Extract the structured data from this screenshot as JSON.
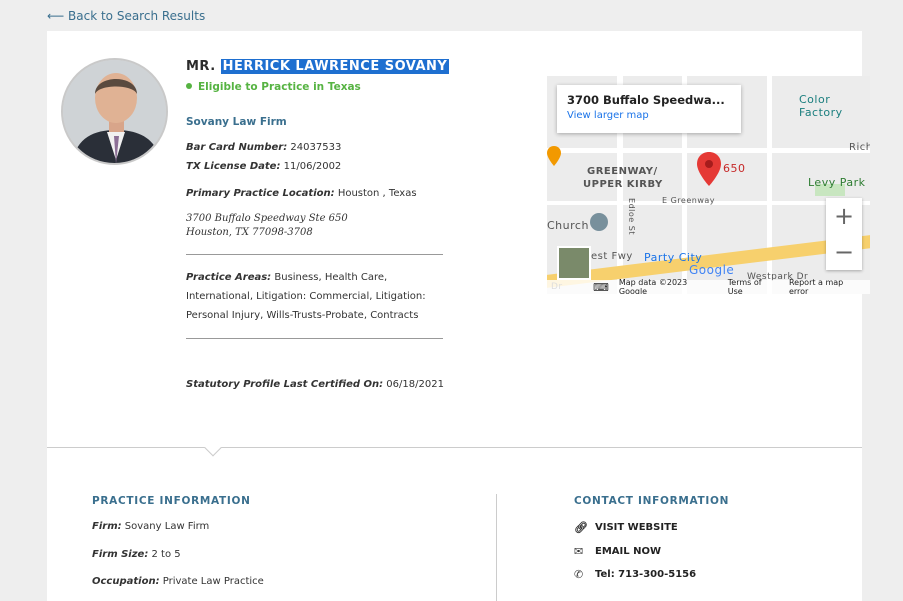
{
  "nav": {
    "back_label": "⟵ Back to Search Results"
  },
  "profile": {
    "prefix": "MR.",
    "name": "HERRICK LAWRENCE SOVANY",
    "eligibility": "Eligible to Practice in Texas",
    "firm": "Sovany Law Firm",
    "bar_card_label": "Bar Card Number:",
    "bar_card_value": "24037533",
    "license_label": "TX License Date:",
    "license_value": "11/06/2002",
    "location_label": "Primary Practice Location:",
    "location_value": "Houston , Texas",
    "address_line1": "3700 Buffalo Speedway Ste 650",
    "address_line2": "Houston, TX 77098-3708",
    "practice_areas_label": "Practice Areas:",
    "practice_areas_value": "Business, Health Care, International, Litigation: Commercial, Litigation: Personal Injury, Wills-Trusts-Probate, Contracts",
    "certified_label": "Statutory Profile Last Certified On:",
    "certified_value": "06/18/2021"
  },
  "map": {
    "popup_title": "3700 Buffalo Speedwa...",
    "popup_link": "View larger map",
    "labels": {
      "color_factory": "Color Factory",
      "greenway": "GREENWAY/",
      "upper_kirby": "UPPER KIRBY",
      "church": "Church",
      "levy_park": "Levy Park",
      "party_city": "Party City",
      "pin_number": "650",
      "rich": "Rich",
      "e_greenway": "E Greenway",
      "edloe": "Edloe St",
      "fwy": "est Fwy",
      "westpark": "Westpark Dr",
      "dr": "Dr"
    },
    "zoom_in": "+",
    "zoom_out": "−",
    "footer": {
      "keyboard": "⌨",
      "google": "Google",
      "map_data": "Map data ©2023 Google",
      "terms": "Terms of Use",
      "report": "Report a map error"
    }
  },
  "practice_info": {
    "title": "PRACTICE INFORMATION",
    "firm_label": "Firm:",
    "firm_value": "Sovany Law Firm",
    "size_label": "Firm Size:",
    "size_value": "2 to 5",
    "occupation_label": "Occupation:",
    "occupation_value": "Private Law Practice"
  },
  "contact_info": {
    "title": "CONTACT INFORMATION",
    "website": "VISIT WEBSITE",
    "email": "EMAIL NOW",
    "phone": "Tel: 713-300-5156"
  },
  "colors": {
    "accent": "#3a6f8e",
    "eligible": "#56b342",
    "highlight": "#1e6fd0"
  }
}
